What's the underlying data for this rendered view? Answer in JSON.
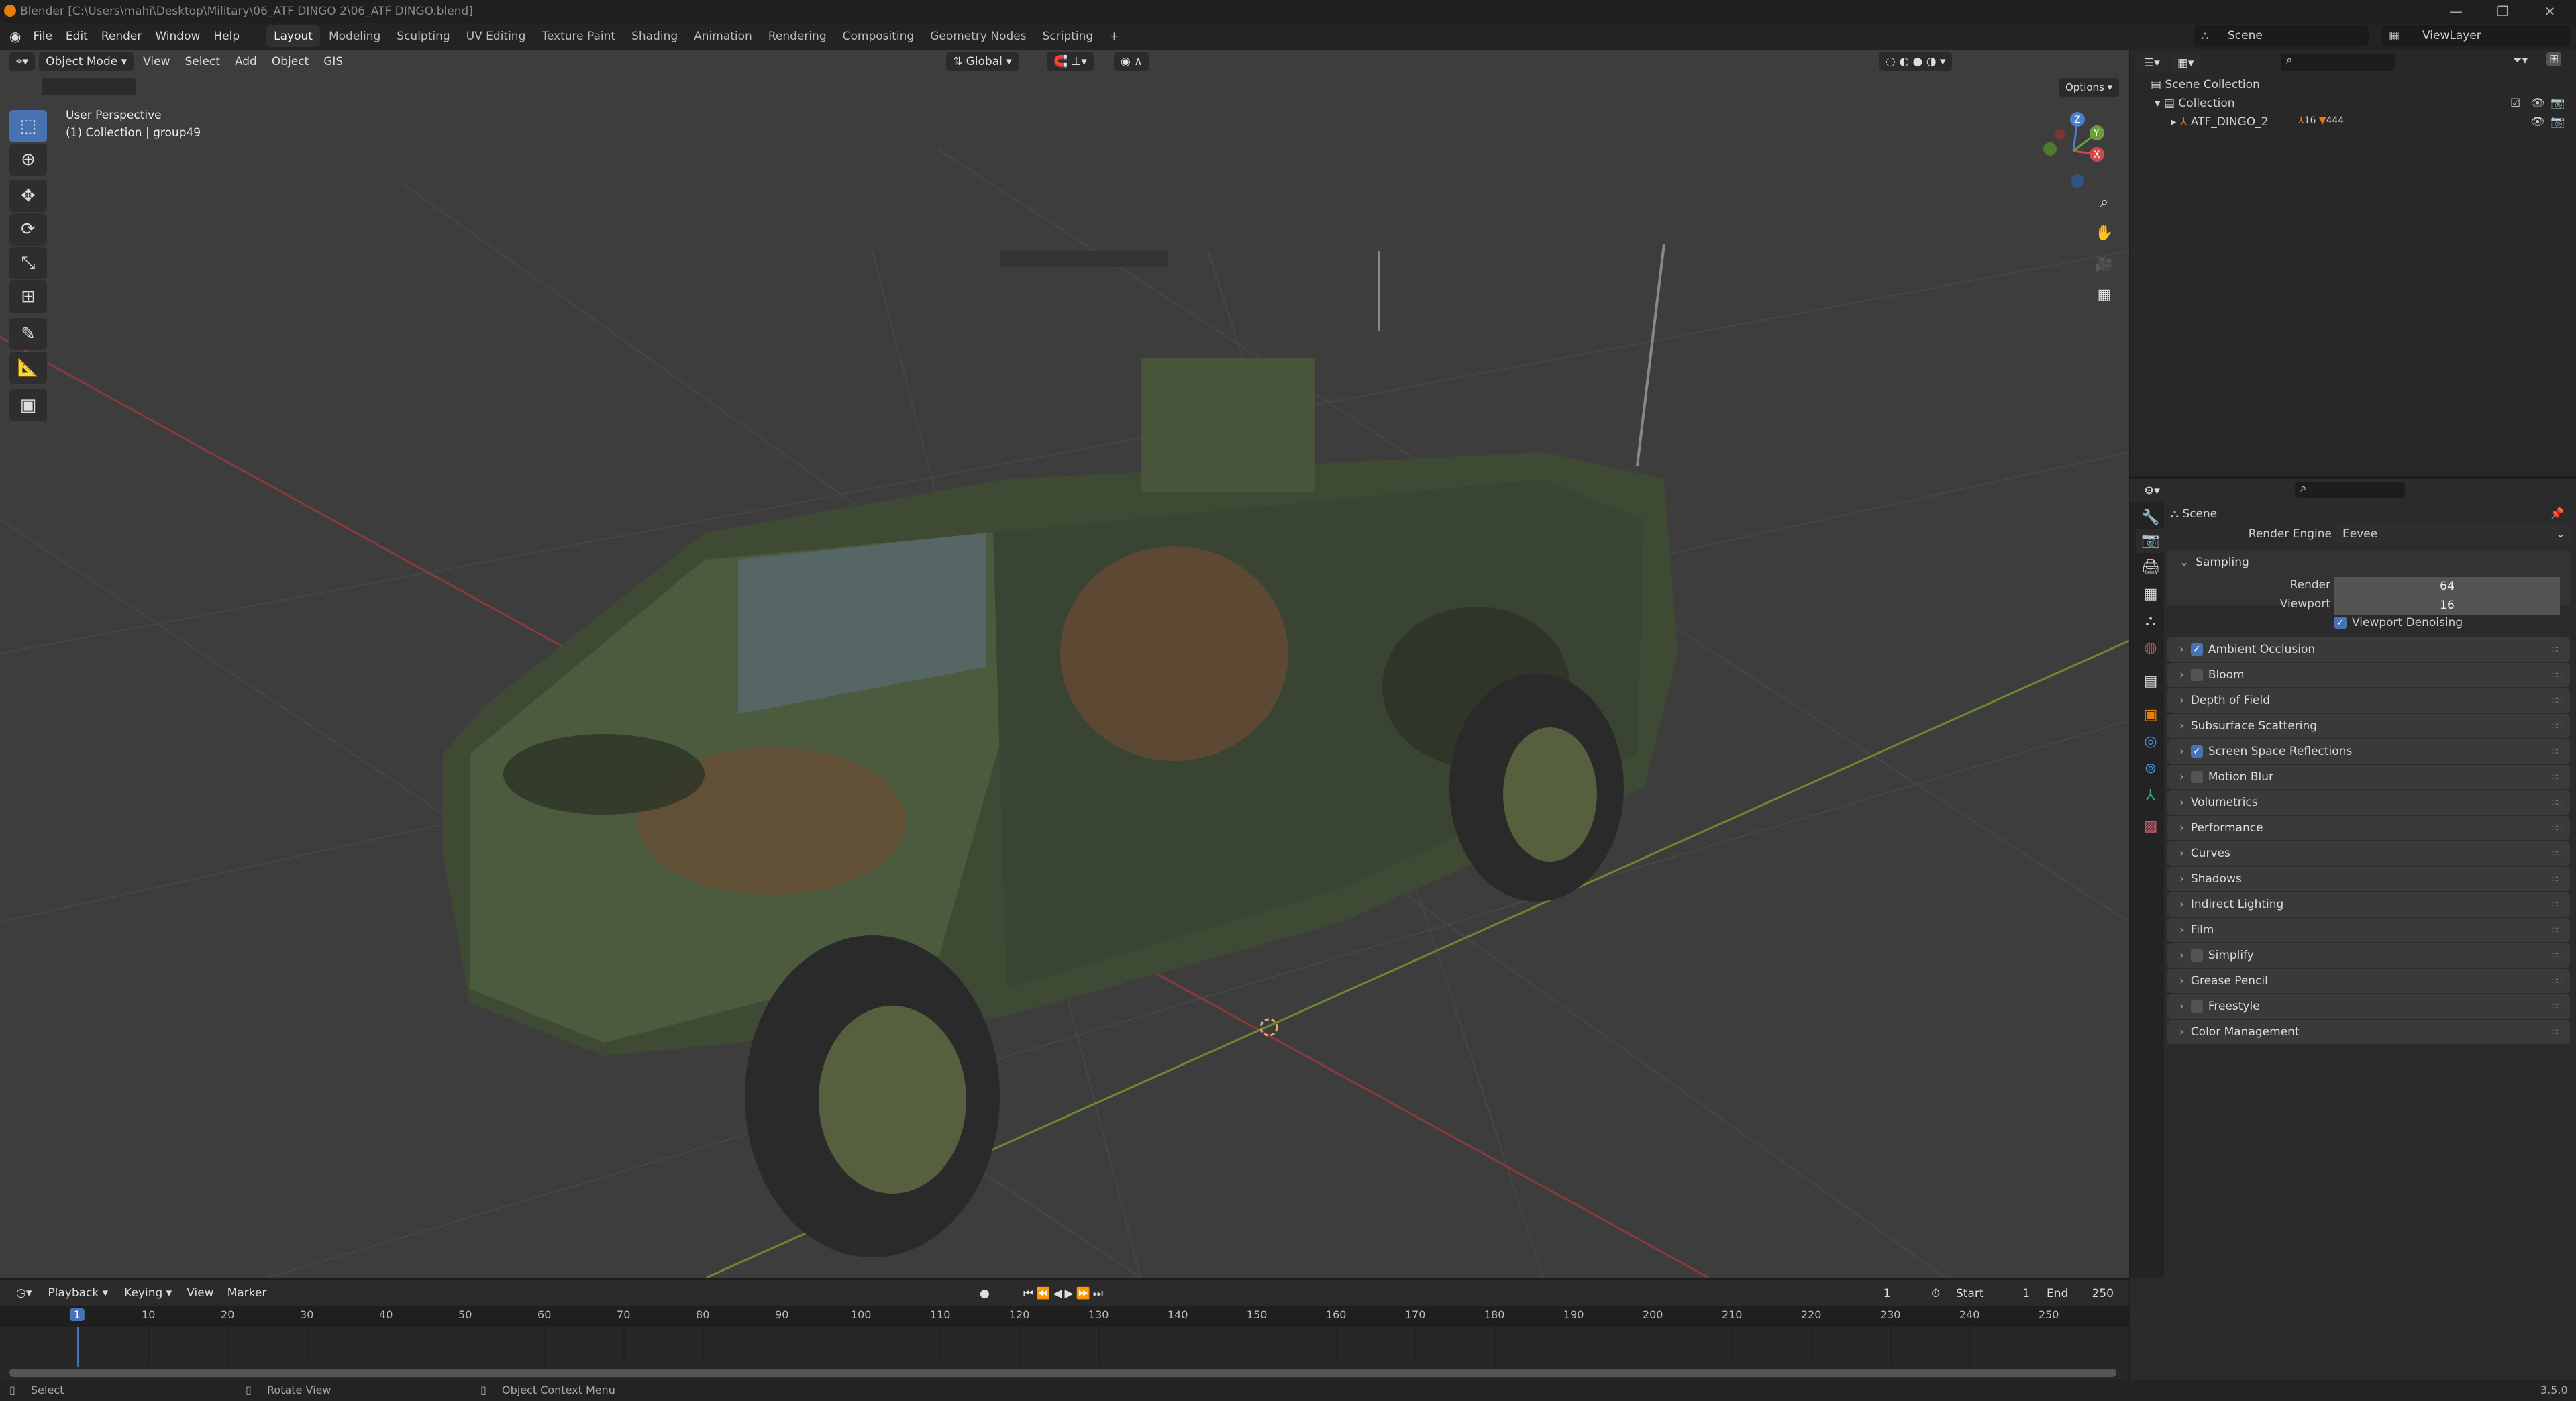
{
  "window": {
    "title": "Blender [C:\\Users\\mahi\\Desktop\\Military\\06_ATF DINGO 2\\06_ATF DINGO.blend]",
    "minimize": "—",
    "maximize": "❐",
    "close": "✕"
  },
  "menu": [
    "File",
    "Edit",
    "Render",
    "Window",
    "Help"
  ],
  "workspaces": [
    "Layout",
    "Modeling",
    "Sculpting",
    "UV Editing",
    "Texture Paint",
    "Shading",
    "Animation",
    "Rendering",
    "Compositing",
    "Geometry Nodes",
    "Scripting",
    "+"
  ],
  "viewport": {
    "mode": "Object Mode",
    "menus": [
      "View",
      "Select",
      "Add",
      "Object",
      "GIS"
    ],
    "orientation": "Global",
    "options": "Options",
    "perspective": "User Perspective",
    "context": "(1) Collection | group49",
    "gizmo": {
      "x": "X",
      "y": "Y",
      "z": "Z"
    }
  },
  "top_right": {
    "scene": "Scene",
    "view_layer": "ViewLayer"
  },
  "outliner": {
    "items": [
      {
        "label": "Scene Collection"
      },
      {
        "label": "Collection"
      },
      {
        "label": "ATF_DINGO_2",
        "badge1": "16",
        "badge2": "444"
      }
    ]
  },
  "properties": {
    "title": "Scene",
    "render_engine_label": "Render Engine",
    "render_engine": "Eevee",
    "sampling": {
      "label": "Sampling",
      "render_label": "Render",
      "render": "64",
      "viewport_label": "Viewport",
      "viewport": "16",
      "denoise": "Viewport Denoising"
    },
    "panels": [
      {
        "label": "Ambient Occlusion",
        "cb": true
      },
      {
        "label": "Bloom",
        "cb": false
      },
      {
        "label": "Depth of Field"
      },
      {
        "label": "Subsurface Scattering"
      },
      {
        "label": "Screen Space Reflections",
        "cb": true
      },
      {
        "label": "Motion Blur",
        "cb": false
      },
      {
        "label": "Volumetrics"
      },
      {
        "label": "Performance"
      },
      {
        "label": "Curves"
      },
      {
        "label": "Shadows"
      },
      {
        "label": "Indirect Lighting"
      },
      {
        "label": "Film"
      },
      {
        "label": "Simplify",
        "cb": false
      },
      {
        "label": "Grease Pencil"
      },
      {
        "label": "Freestyle",
        "cb": false
      },
      {
        "label": "Color Management"
      }
    ]
  },
  "timeline": {
    "menus": [
      "Playback",
      "Keying",
      "View",
      "Marker"
    ],
    "current_frame": "1",
    "start_label": "Start",
    "start": "1",
    "end_label": "End",
    "end": "250",
    "ticks": [
      "1",
      "10",
      "20",
      "30",
      "40",
      "50",
      "60",
      "70",
      "80",
      "90",
      "100",
      "110",
      "120",
      "130",
      "140",
      "150",
      "160",
      "170",
      "180",
      "190",
      "200",
      "210",
      "220",
      "230",
      "240",
      "250"
    ]
  },
  "status": {
    "select": "Select",
    "rotate": "Rotate View",
    "context_menu": "Object Context Menu",
    "version": "3.5.0"
  },
  "colors": {
    "accent": "#4772b3",
    "orange": "#e87d0d"
  }
}
